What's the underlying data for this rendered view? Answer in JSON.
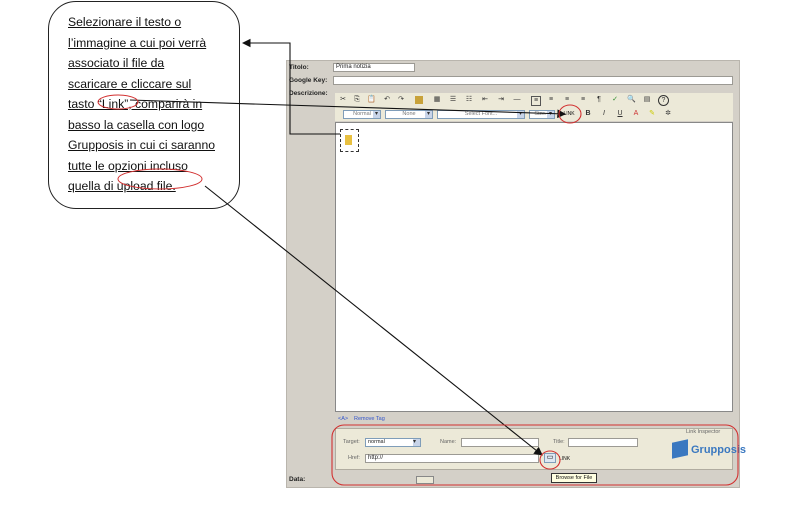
{
  "callout": {
    "lines": [
      "Selezionare il testo o",
      "l’immagine a cui poi verrà",
      "associato il file da",
      "scaricare e cliccare sul",
      "tasto “Link”, comparirà in",
      "basso la casella con logo",
      "Grupposis in cui ci saranno",
      "tutte le opzioni incluso",
      "quella di upload file."
    ]
  },
  "form": {
    "title_label": "Titolo:",
    "title_value": "Prima notizia",
    "google_key_label": "Google Key:",
    "description_label": "Descrizione:",
    "data_label": "Data:"
  },
  "toolbar": {
    "format_select": "Normal",
    "style_select": "None",
    "font_select": "Select Font...",
    "size_select": "Size...",
    "link_label": "LINK",
    "bold": "B",
    "italic": "I",
    "underline": "U"
  },
  "tagbar": {
    "path": "<A>",
    "remove_tag": "Remove Tag"
  },
  "inspector": {
    "title": "Link Inspector",
    "target_label": "Target:",
    "target_value": "normal",
    "name_label": "Name:",
    "title_label": "Title:",
    "href_label": "Href:",
    "href_value": "http://",
    "link_label": "LINK",
    "brand": "Grupposis"
  },
  "tooltip": {
    "browse": "Browse for File"
  },
  "colors": {
    "highlight_circle": "#d23030",
    "arrow": "#111111",
    "panel": "#d4d0c8"
  }
}
